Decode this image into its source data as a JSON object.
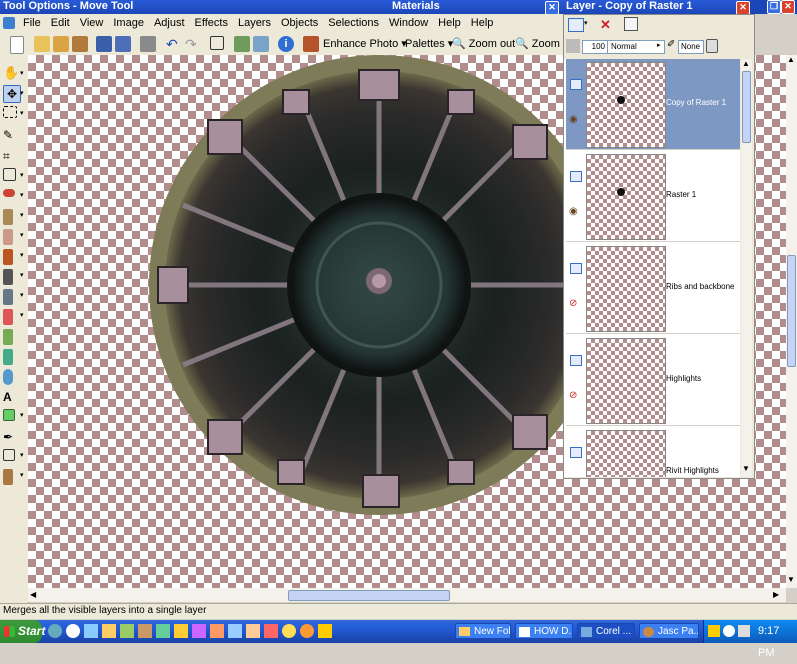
{
  "window": {
    "title": "Tool Options - Move Tool",
    "materials_title": "Materials",
    "layer_title": "Layer - Copy of Raster 1"
  },
  "menu": [
    "File",
    "Edit",
    "View",
    "Image",
    "Adjust",
    "Effects",
    "Layers",
    "Objects",
    "Selections",
    "Window",
    "Help",
    "Help"
  ],
  "toolbar": {
    "enhance_photo": "Enhance Photo",
    "palettes": "Palettes",
    "zoom_out": "Zoom out",
    "zoom_in": "Zoom in"
  },
  "layer_palette": {
    "opacity": "100",
    "blend_mode": "Normal",
    "mask": "None",
    "layers": [
      {
        "name": "Copy of Raster 1",
        "selected": true,
        "visible": true,
        "dot": true
      },
      {
        "name": "Raster 1",
        "selected": false,
        "visible": true,
        "dot": true
      },
      {
        "name": "Ribs and backbone",
        "selected": false,
        "visible": false,
        "dot": false
      },
      {
        "name": "Highlights",
        "selected": false,
        "visible": false,
        "dot": false
      },
      {
        "name": "Rivit Highlights",
        "selected": false,
        "visible": true,
        "dot": false
      }
    ]
  },
  "status": {
    "text": "Merges all the visible layers into a single layer"
  },
  "taskbar": {
    "start": "Start",
    "items": [
      "New Fol...",
      "HOW D...",
      "Corel ...",
      "Jasc Pa..."
    ],
    "clock": "9:17 PM"
  },
  "colors": {
    "xp_blue": "#245edb",
    "selected_layer": "#7e98c4",
    "checker": "#b38c8e"
  }
}
